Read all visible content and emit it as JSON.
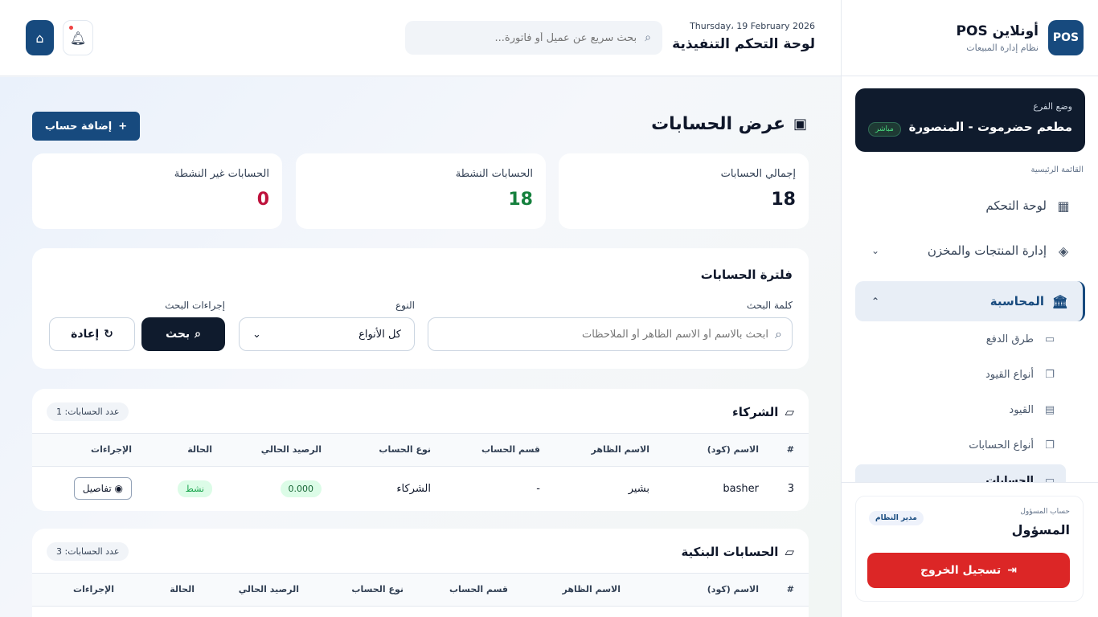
{
  "brand": {
    "logo": "POS",
    "title": "أونلاين POS",
    "subtitle": "نظام إدارة المبيعات"
  },
  "branch": {
    "label": "وضع الفرع",
    "name": "مطعم حضرموت - المنصورة",
    "badge": "مباشر"
  },
  "menu": {
    "caption": "القائمة الرئيسية",
    "dashboard": "لوحة التحكم",
    "products": "إدارة المنتجات والمخزن",
    "accounting": "المحاسبة",
    "sub_items": [
      "طرق الدفع",
      "أنواع القيود",
      "القيود",
      "أنواع الحسابات",
      "الحسابات"
    ]
  },
  "user": {
    "label": "حساب المسؤول",
    "name": "المسؤول",
    "role": "مدير النظام",
    "logout": "تسجيل الخروج"
  },
  "header": {
    "date": "Thursday، 19 February 2026",
    "title": "لوحة التحكم التنفيذية",
    "search_placeholder": "بحث سريع عن عميل أو فاتورة..."
  },
  "page": {
    "title": "عرض الحسابات",
    "add_button": "إضافة حساب"
  },
  "stats": [
    {
      "label": "إجمالي الحسابات",
      "value": "18",
      "color": "#0f172a"
    },
    {
      "label": "الحسابات النشطة",
      "value": "18",
      "color": "#15803d"
    },
    {
      "label": "الحسابات غير النشطة",
      "value": "0",
      "color": "#be123c"
    }
  ],
  "filter": {
    "title": "فلترة الحسابات",
    "keyword_label": "كلمة البحث",
    "keyword_placeholder": "ابحث بالاسم أو الاسم الظاهر أو الملاحظات",
    "type_label": "النوع",
    "type_value": "كل الأنواع",
    "actions_label": "إجراءات البحث",
    "search_button": "بحث",
    "reset_button": "إعادة"
  },
  "columns": [
    "#",
    "الاسم (كود)",
    "الاسم الظاهر",
    "قسم الحساب",
    "نوع الحساب",
    "الرصيد الحالي",
    "الحالة",
    "الإجراءات"
  ],
  "partners": {
    "title": "الشركاء",
    "count": "عدد الحسابات: 1",
    "rows": [
      {
        "num": "3",
        "code": "basher",
        "display": "بشير",
        "section": "-",
        "type": "الشركاء",
        "balance": "0.000",
        "status": "نشط",
        "action": "تفاصيل"
      }
    ]
  },
  "banks": {
    "title": "الحسابات البنكية",
    "count": "عدد الحسابات: 3"
  }
}
